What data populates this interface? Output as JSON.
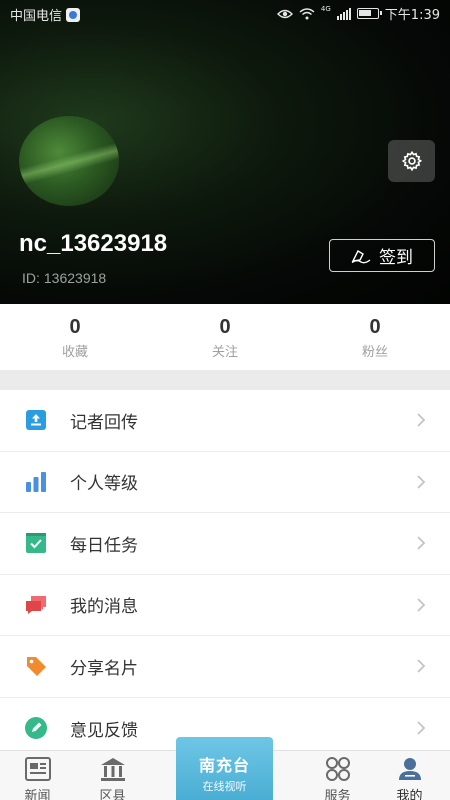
{
  "status_bar": {
    "carrier": "中国电信",
    "network": "4G",
    "time": "下午1:39"
  },
  "profile": {
    "username": "nc_13623918",
    "id_label": "ID:",
    "id_value": "13623918",
    "checkin_label": "签到"
  },
  "stats": [
    {
      "value": "0",
      "label": "收藏"
    },
    {
      "value": "0",
      "label": "关注"
    },
    {
      "value": "0",
      "label": "粉丝"
    }
  ],
  "menu": [
    {
      "label": "记者回传",
      "icon": "upload-icon",
      "color": "#2a9de0"
    },
    {
      "label": "个人等级",
      "icon": "bar-chart-icon",
      "color": "#4a90e2"
    },
    {
      "label": "每日任务",
      "icon": "checkmark-icon",
      "color": "#35b98a"
    },
    {
      "label": "我的消息",
      "icon": "messages-icon",
      "color": "#e0454a"
    },
    {
      "label": "分享名片",
      "icon": "tag-icon",
      "color": "#f28a2e"
    },
    {
      "label": "意见反馈",
      "icon": "pen-icon",
      "color": "#35b98a"
    }
  ],
  "tabbar": {
    "tabs": [
      {
        "label": "新闻",
        "icon": "news-icon"
      },
      {
        "label": "区县",
        "icon": "building-icon"
      },
      {
        "label": "服务",
        "icon": "grid-icon"
      },
      {
        "label": "我的",
        "icon": "user-icon"
      }
    ],
    "center": {
      "title": "南充台",
      "subtitle": "在线视听"
    }
  },
  "colors": {
    "accent_blue": "#4aaed3",
    "active_user_icon": "#4a6f9a"
  }
}
